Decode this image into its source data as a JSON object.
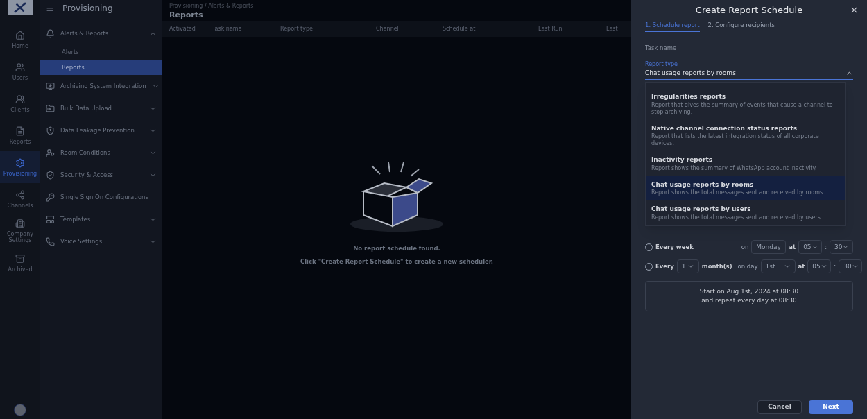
{
  "rail": {
    "items": [
      {
        "label": "Home",
        "selected": false
      },
      {
        "label": "Users",
        "selected": false
      },
      {
        "label": "Clients",
        "selected": false
      },
      {
        "label": "Reports",
        "selected": false
      },
      {
        "label": "Provisioning",
        "selected": true
      },
      {
        "label": "Channels",
        "selected": false
      },
      {
        "label": "Company Settings",
        "selected": false
      },
      {
        "label": "Archived",
        "selected": false
      }
    ]
  },
  "sidebar": {
    "title": "Provisioning",
    "groups": [
      {
        "label": "Alerts & Reports",
        "expandable": true,
        "expanded": true,
        "children": [
          {
            "label": "Alerts",
            "selected": false
          },
          {
            "label": "Reports",
            "selected": true
          }
        ]
      },
      {
        "label": "Archiving System Integration",
        "expandable": true,
        "expanded": false
      },
      {
        "label": "Bulk Data Upload",
        "expandable": true,
        "expanded": false
      },
      {
        "label": "Data Leakage Prevention",
        "expandable": true,
        "expanded": false
      },
      {
        "label": "Room Conditions",
        "expandable": true,
        "expanded": false
      },
      {
        "label": "Security & Access",
        "expandable": true,
        "expanded": false
      },
      {
        "label": "Single Sign On Configurations",
        "expandable": false,
        "expanded": false
      },
      {
        "label": "Templates",
        "expandable": true,
        "expanded": false
      },
      {
        "label": "Voice Settings",
        "expandable": true,
        "expanded": false
      }
    ]
  },
  "main": {
    "breadcrumb": "Provisioning / Alerts & Reports",
    "title": "Reports",
    "columns": [
      "Activated",
      "Task name",
      "Report type",
      "Channel",
      "Schedule at",
      "Last Run",
      "Last"
    ],
    "empty": {
      "message": "No report schedule found.",
      "hint": "Click \"Create Report Schedule\" to create a new scheduler."
    }
  },
  "drawer": {
    "title": "Create Report Schedule",
    "steps": [
      {
        "label": "1. Schedule report",
        "selected": true
      },
      {
        "label": "2. Configure recipients",
        "selected": false
      }
    ],
    "task_name": {
      "placeholder": "Task name"
    },
    "report_type": {
      "label": "Report type",
      "value": "Chat usage reports by rooms",
      "open": true,
      "options": [
        {
          "title": "Irregularities reports",
          "description": "Report that gives the summary of events that cause a channel to stop archiving.",
          "selected": false
        },
        {
          "title": "Native channel connection status reports",
          "description": "Report that lists the latest integration status of all corporate devices.",
          "selected": false
        },
        {
          "title": "Inactivity reports",
          "description": "Report shows the summary of WhatsApp account inactivity.",
          "selected": false
        },
        {
          "title": "Chat usage reports by rooms",
          "description": "Report shows the total messages sent and received by rooms",
          "selected": true
        },
        {
          "title": "Chat usage reports by users",
          "description": "Report shows the total messages sent and received by users",
          "selected": false
        }
      ]
    },
    "schedules": [
      {
        "kind": "weekly",
        "selected": false,
        "label": "Every week",
        "on_label": "on",
        "day": "Monday",
        "at_label": "at",
        "hour": "05",
        "separator": ":",
        "minute": "30"
      },
      {
        "kind": "monthly",
        "selected": false,
        "label": "Every",
        "count": "1",
        "unit": "month(s)",
        "on_label": "on day",
        "day": "1st",
        "at_label": "at",
        "hour": "05",
        "separator": ":",
        "minute": "30"
      }
    ],
    "summary": [
      "Start on Aug 1st, 2024 at 08:30",
      "and repeat every day at 08:30"
    ],
    "buttons": {
      "cancel": "Cancel",
      "next": "Next"
    }
  }
}
